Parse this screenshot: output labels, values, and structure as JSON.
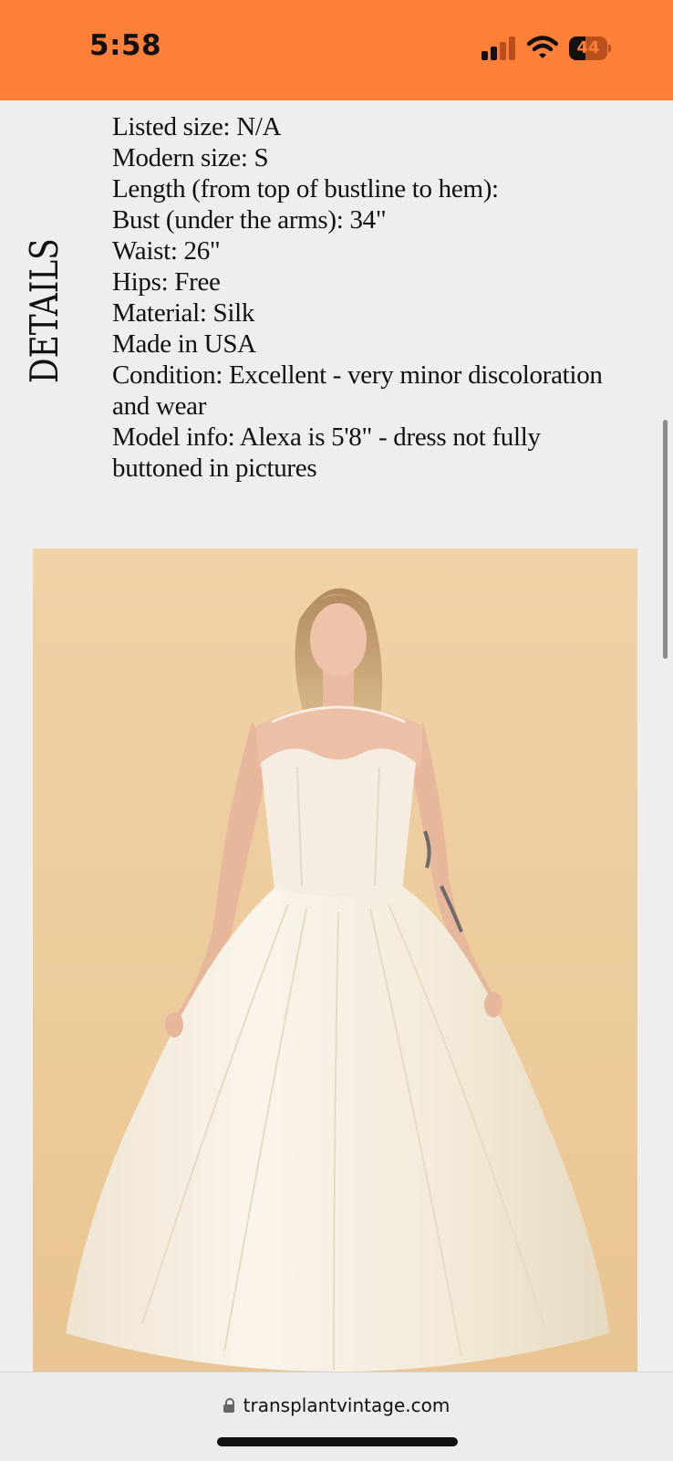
{
  "status_bar": {
    "time": "5:58",
    "battery_level": "44",
    "battery_fraction": 0.44,
    "signal_bars_active": 2,
    "signal_bars_total": 4,
    "background_color": "#ff8039",
    "icons": [
      "signal-icon",
      "wifi-icon",
      "battery-icon"
    ]
  },
  "details": {
    "heading": "DETAILS",
    "lines": [
      "Listed size: N/A",
      "Modern size: S",
      "Length (from top of bustline to hem):",
      "Bust (under the arms): 34\"",
      "Waist: 26\"",
      "Hips: Free",
      "Material: Silk",
      "Made in USA",
      "Condition: Excellent - very minor discoloration and wear",
      "Model info: Alexa is 5'8\" - dress not fully buttoned in pictures"
    ]
  },
  "product_photo": {
    "background_color": "#eccb9a"
  },
  "browser": {
    "url": "transplantvintage.com",
    "lock_icon": "lock-icon"
  }
}
